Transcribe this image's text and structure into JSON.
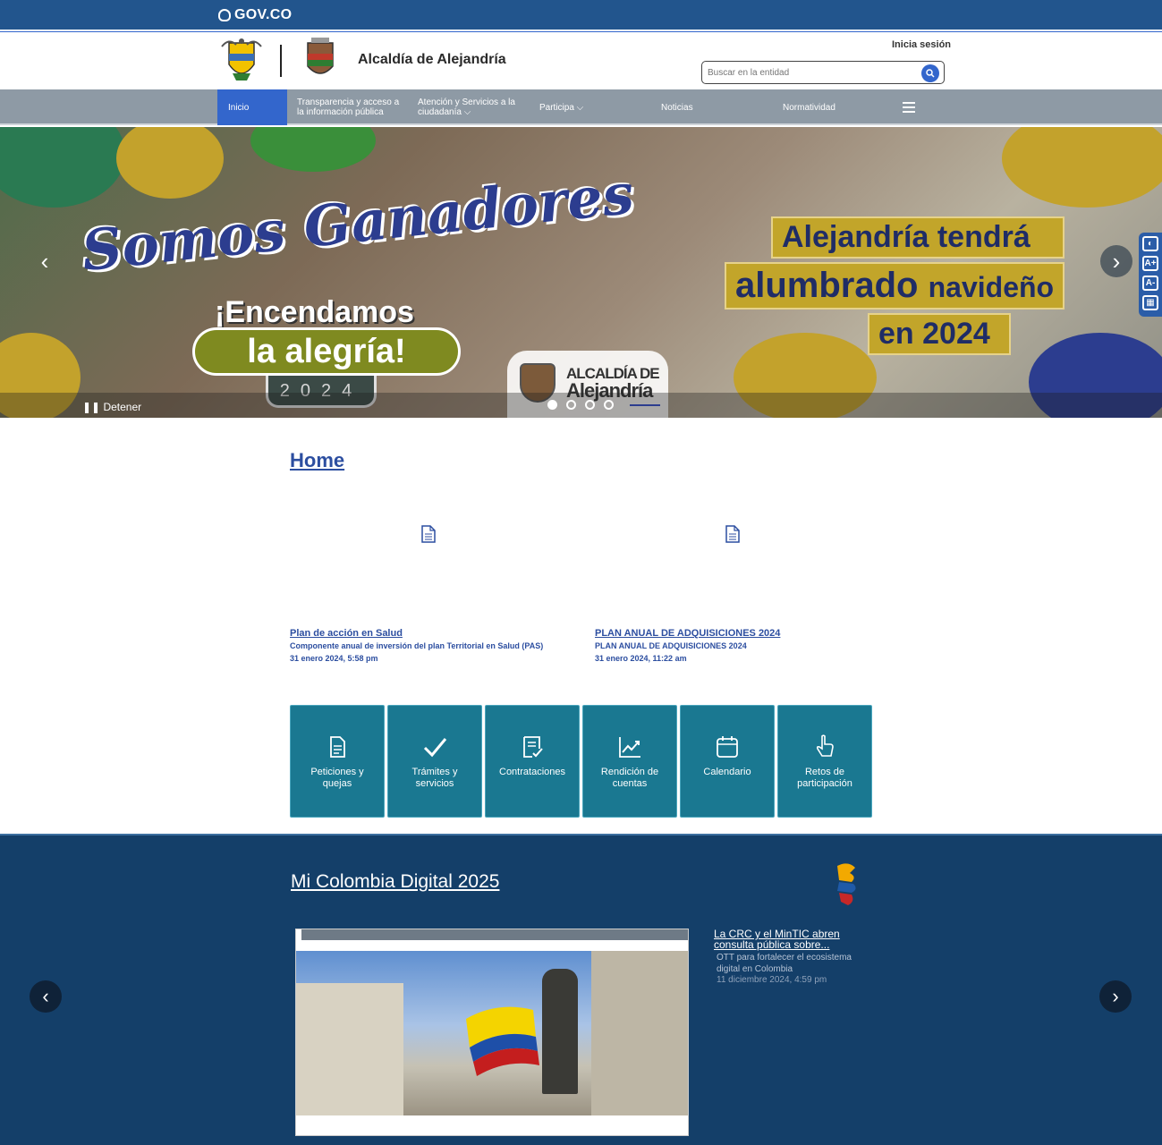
{
  "govbar": {
    "brand": "GOV.CO"
  },
  "header": {
    "site_name": "Alcaldía de Alejandría",
    "login": "Inicia sesión",
    "search_placeholder": "Buscar en la entidad"
  },
  "nav": {
    "items": [
      {
        "label": "Inicio"
      },
      {
        "label": "Transparencia y acceso a la información pública"
      },
      {
        "label": "Atención y Servicios a la ciudadanía ⌵"
      },
      {
        "label": "Participa ⌵"
      },
      {
        "label": "Noticias"
      },
      {
        "label": "Normatividad"
      }
    ]
  },
  "hero": {
    "script_text": "Somos Ganadores",
    "tagline_1": "¡Encendamos",
    "tagline_2": "la alegría!",
    "year": "2024",
    "headline_1": "Alejandría tendrá",
    "headline_2a": "alumbrado",
    "headline_2b": "navideño",
    "headline_3": "en 2024",
    "badge_1": "ALCALDÍA DE",
    "badge_2": "Alejandría",
    "stop_label": "Detener",
    "slides_total": 4,
    "active_slide": 1
  },
  "accessibility": {
    "buttons": [
      {
        "label": "◐"
      },
      {
        "label": "A+"
      },
      {
        "label": "A-"
      },
      {
        "label": "▦"
      }
    ]
  },
  "home": {
    "title": "Home",
    "cards": [
      {
        "title": "Plan de acción en Salud",
        "subtitle": "Componente anual de inversión del plan Territorial en Salud (PAS)",
        "date": "31 enero 2024, 5:58 pm"
      },
      {
        "title": "PLAN ANUAL DE ADQUISICIONES 2024",
        "subtitle": "PLAN ANUAL DE ADQUISICIONES 2024",
        "date": "31 enero 2024, 11:22 am"
      }
    ]
  },
  "tiles": [
    {
      "label": "Peticiones y quejas",
      "icon": "document-icon"
    },
    {
      "label": "Trámites y servicios",
      "icon": "check-icon"
    },
    {
      "label": "Contrataciones",
      "icon": "contract-icon"
    },
    {
      "label": "Rendición de cuentas",
      "icon": "chart-icon"
    },
    {
      "label": "Calendario",
      "icon": "calendar-icon"
    },
    {
      "label": "Retos de participación",
      "icon": "hand-pointer-icon"
    }
  ],
  "digital": {
    "title": "Mi Colombia Digital 2025",
    "news_title": "La CRC y el MinTIC abren consulta pública sobre...",
    "news_subtitle": "OTT para fortalecer el ecosistema digital en Colombia",
    "news_date": "11 diciembre 2024, 4:59 pm"
  },
  "colors": {
    "govbar": "#22558d",
    "nav": "#8e9aa5",
    "active": "#3366cc",
    "tile": "#1a7891",
    "digital_bg": "#143f69"
  }
}
